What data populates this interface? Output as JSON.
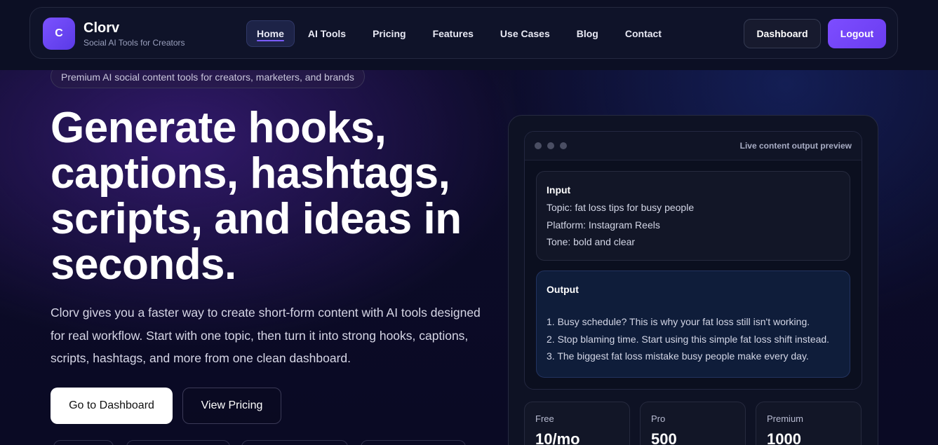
{
  "brand": {
    "logo_letter": "C",
    "name": "Clorv",
    "tagline": "Social AI Tools for Creators"
  },
  "nav": {
    "items": [
      {
        "label": "Home",
        "active": true
      },
      {
        "label": "AI Tools"
      },
      {
        "label": "Pricing"
      },
      {
        "label": "Features"
      },
      {
        "label": "Use Cases"
      },
      {
        "label": "Blog"
      },
      {
        "label": "Contact"
      }
    ],
    "dashboard_label": "Dashboard",
    "logout_label": "Logout"
  },
  "hero": {
    "pill": "Premium AI social content tools for creators, marketers, and brands",
    "title": "Generate hooks, captions, hashtags, scripts, and ideas in seconds.",
    "description": "Clorv gives you a faster way to create short-form content with AI tools designed for real workflow. Start with one topic, then turn it into strong hooks, captions, scripts, hashtags, and more from one clean dashboard.",
    "primary_cta": "Go to Dashboard",
    "secondary_cta": "View Pricing"
  },
  "preview": {
    "window_title": "Live content output preview",
    "input": {
      "heading": "Input",
      "lines": [
        "Topic: fat loss tips for busy people",
        "Platform: Instagram Reels",
        "Tone: bold and clear"
      ]
    },
    "output": {
      "heading": "Output",
      "lines": [
        "1. Busy schedule? This is why your fat loss still isn't working.",
        "2. Stop blaming time. Start using this simple fat loss shift instead.",
        "3. The biggest fat loss mistake busy people make every day."
      ]
    },
    "plans": [
      {
        "name": "Free",
        "value": "10/mo"
      },
      {
        "name": "Pro",
        "value": "500"
      },
      {
        "name": "Premium",
        "value": "1000"
      }
    ]
  },
  "colors": {
    "accent": "#7b52ff",
    "background": "#0d0c2a",
    "output_card": "#0f1d3a"
  }
}
